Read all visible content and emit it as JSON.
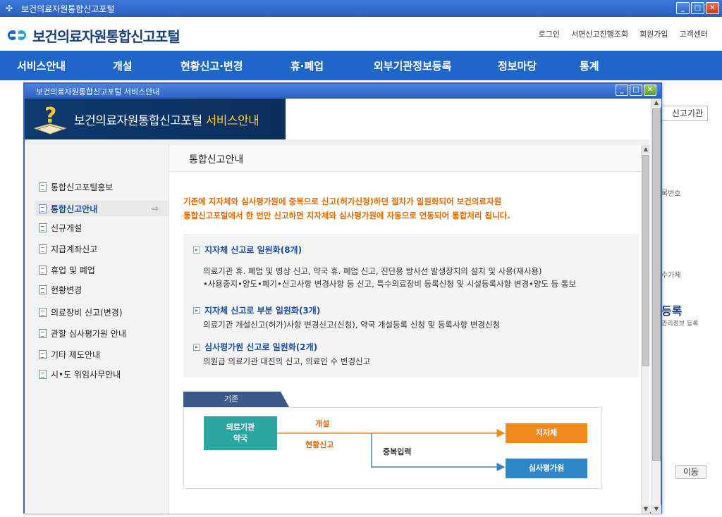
{
  "window": {
    "title": "보건의료자원통합신고포털"
  },
  "site": {
    "logo_text": "보건의료자원통합신고포털",
    "util_links": [
      "로그인",
      "서면신고진행조회",
      "회원가입",
      "고객센터"
    ],
    "nav": [
      "서비스안내",
      "개설",
      "현황신고·변경",
      "휴·폐업",
      "외부기관정보등록",
      "정보마당",
      "통계"
    ]
  },
  "background": {
    "tab_label": "신고기관",
    "text_a": "록번호",
    "text_b": "수가체",
    "big_label": "등록",
    "small_label": "관리정보 등록",
    "move_button": "이동"
  },
  "popup": {
    "title": "보건의료자원통합신고포털 서비스안내",
    "banner_main": "보건의료자원통합신고포털 ",
    "banner_highlight": "서비스안내",
    "menu": [
      {
        "label": "통합신고포털홍보"
      },
      {
        "label": "통합신고안내",
        "arrow": "⇨"
      },
      {
        "label": "신규개설"
      },
      {
        "label": "지급계좌신고"
      },
      {
        "label": "휴업 및 폐업"
      },
      {
        "label": "현황변경"
      },
      {
        "label": "의료장비 신고(변경)"
      },
      {
        "label": "관할 심사평가원 안내"
      },
      {
        "label": "기타 제도안내"
      },
      {
        "label": "시•도 위임사무안내"
      }
    ],
    "content": {
      "title": "통합신고안내",
      "intro_1": "기존에 지자체와 심사평가원에 중복으로 신고(허가신청)하던 절차가 일원화되어 보건의료자원",
      "intro_2": "통합신고포털에서 한 번만 신고하면 지자체와 심사평가원에 자동으로 연동되어 통합처리 됩니다.",
      "sections": [
        {
          "title": "지자체 신고로 일원화(8개)",
          "desc_1": "의료기관 휴. 폐업 및 병상 신고, 약국 휴. 폐업 신고, 진단용 방사선 발생장치의 설치 및 사용(재사용)",
          "desc_2": "•사용중지•양도•폐기•신고사항 변경사항 등 신고, 특수의료장비 등록신청 및 시설등록사항 변경•양도 등 통보"
        },
        {
          "title": "지자체 신고로 부분 일원화(3개)",
          "desc_1": "의료기관 개설신고(허가)사항 변경신고(신청), 약국 개설등록 신청 및 등록사항 변경신청"
        },
        {
          "title": "심사평가원 신고로 일원화(2개)",
          "desc_1": "의원급 의료기관 대진의 신고, 의료인 수 변경신고"
        }
      ],
      "flow": {
        "tab": "기존",
        "source_line1": "의료기관",
        "source_line2": "약국",
        "label_open": "개설",
        "label_status": "현황신고",
        "label_duplicate": "중복입력",
        "target_1": "지자체",
        "target_2": "심사평가원"
      }
    }
  },
  "colors": {
    "nav_bg": "#1f66c9",
    "banner_bg": "#0e3a6e",
    "intro_text": "#e06a00",
    "teal": "#2aa7a0",
    "orange": "#f08a1c",
    "blue": "#2f86c8"
  }
}
